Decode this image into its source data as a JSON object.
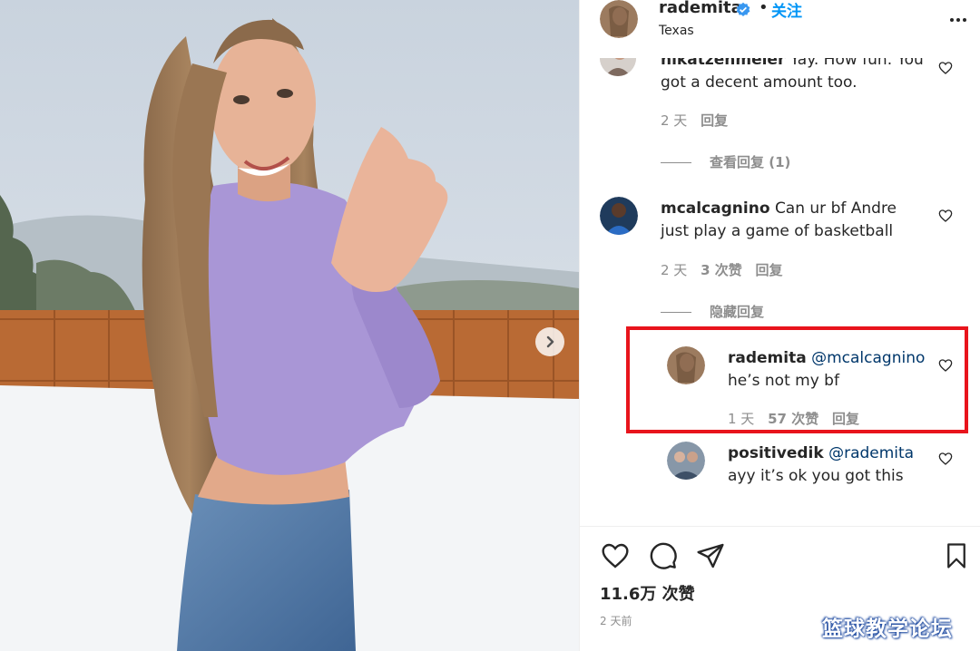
{
  "post": {
    "username": "rademita",
    "separator": "•",
    "follow_label": "关注",
    "location": "Texas",
    "likes": "11.6万 次赞",
    "posted": "2 天前"
  },
  "comments": [
    {
      "username": "nikatzenmeier",
      "text": "Yay. How fun. You got a decent amount too.",
      "time": "2 天",
      "likes": "",
      "reply_label": "回复",
      "thread_toggle": "查看回复 (1)"
    },
    {
      "username": "mcalcagnino",
      "text": "Can ur bf Andre just play a game of basketball",
      "time": "2 天",
      "likes": "3 次赞",
      "reply_label": "回复",
      "thread_toggle": "隐藏回复",
      "replies": [
        {
          "username": "rademita",
          "mention": "@mcalcagnino",
          "text": "he’s not my bf",
          "time": "1 天",
          "likes": "57 次赞",
          "reply_label": "回复"
        },
        {
          "username": "positivedik",
          "mention": "@rademita",
          "text": "ayy it’s ok you got this"
        }
      ]
    }
  ],
  "watermark": "篮球教学论坛",
  "icons": [
    "heart-icon",
    "comment-icon",
    "share-icon",
    "bookmark-icon",
    "more-options-icon",
    "verified-icon",
    "chevron-right-icon"
  ],
  "colors": {
    "link_blue": "#0095f6",
    "mention_blue": "#00376b",
    "highlight_red": "#e8141c",
    "meta_gray": "#8e8e8e"
  }
}
